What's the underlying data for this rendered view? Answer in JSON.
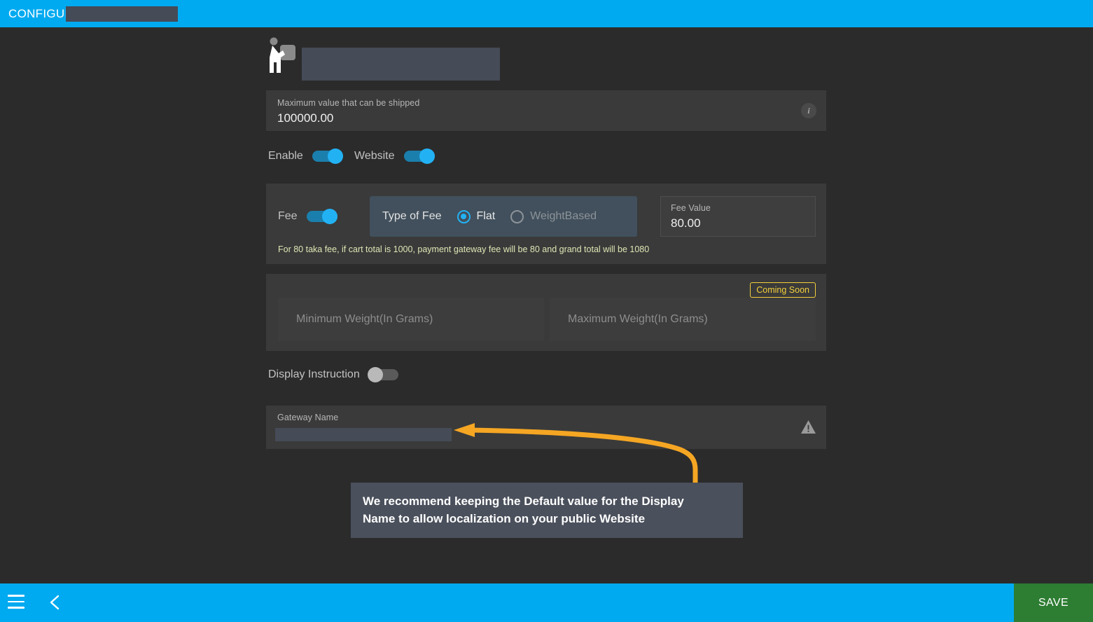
{
  "header": {
    "title": "CONFIGURE",
    "redacted_name": ""
  },
  "gateway": {
    "icon": "shipping-person-box-icon",
    "redacted_logo": ""
  },
  "max_value": {
    "label": "Maximum value that can be shipped",
    "value": "100000.00",
    "info_icon": "info-icon",
    "info_glyph": "i"
  },
  "toggles": {
    "enable": {
      "label": "Enable",
      "state": "on"
    },
    "website": {
      "label": "Website",
      "state": "on"
    },
    "display_instruction": {
      "label": "Display Instruction",
      "state": "off"
    }
  },
  "fee": {
    "toggle_label": "Fee",
    "toggle_state": "on",
    "type_label": "Type of Fee",
    "options": [
      {
        "label": "Flat",
        "selected": true
      },
      {
        "label": "WeightBased",
        "selected": false
      }
    ],
    "value_label": "Fee Value",
    "value": "80.00",
    "note": "For 80 taka fee, if cart total is 1000, payment gateway fee will be 80 and grand total will be 1080"
  },
  "weight": {
    "badge": "Coming Soon",
    "min_placeholder": "Minimum Weight(In Grams)",
    "max_placeholder": "Maximum Weight(In Grams)"
  },
  "gateway_name": {
    "label": "Gateway Name",
    "value": "",
    "warning_icon": "warning-triangle-icon"
  },
  "callout": {
    "line1": "We recommend keeping the Default value for the Display",
    "line2": "Name to allow localization on your public Website",
    "arrow_color": "#f5a623"
  },
  "bottombar": {
    "menu_icon": "hamburger-menu-icon",
    "back_icon": "chevron-left-icon",
    "save_label": "SAVE"
  },
  "colors": {
    "accent_blue": "#00aaf0",
    "toggle_on": "#22b2f4",
    "save_green": "#2d7d32",
    "badge_yellow": "#f2cf3c",
    "note_text": "#dfe6b4",
    "panel": "#3a3a3a",
    "page_bg": "#2b2b2b"
  }
}
